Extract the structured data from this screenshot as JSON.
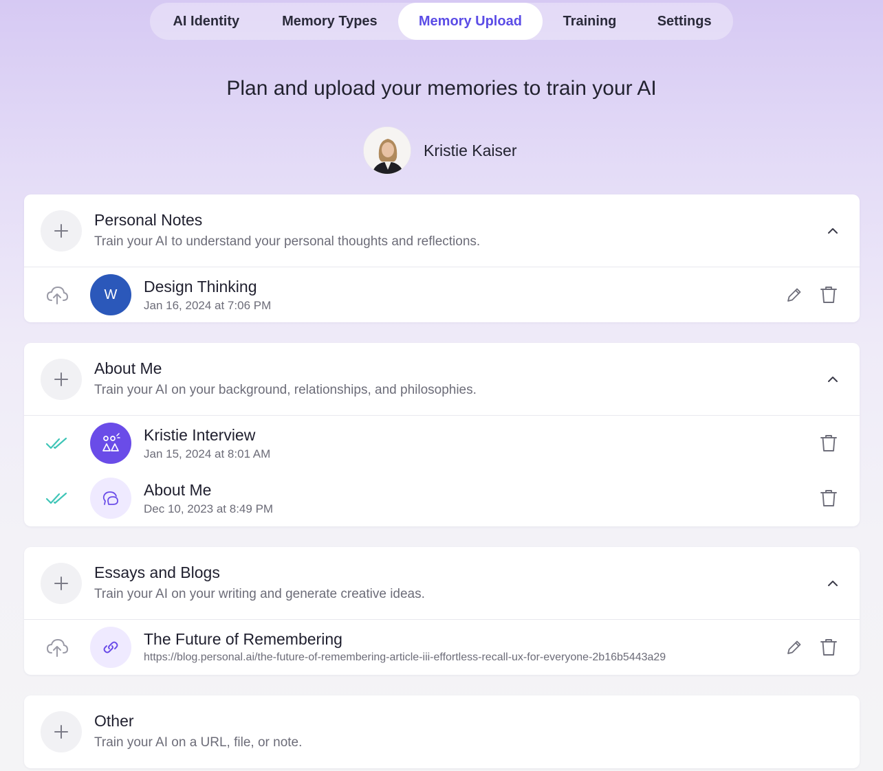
{
  "tabs": [
    {
      "label": "AI Identity",
      "active": false
    },
    {
      "label": "Memory Types",
      "active": false
    },
    {
      "label": "Memory Upload",
      "active": true
    },
    {
      "label": "Training",
      "active": false
    },
    {
      "label": "Settings",
      "active": false
    }
  ],
  "heading": "Plan and upload your memories to train your AI",
  "profile": {
    "name": "Kristie Kaiser"
  },
  "colors": {
    "accent": "#5b4ce6",
    "success": "#3fc5b7",
    "word_blue": "#2b58ba"
  },
  "sections": [
    {
      "title": "Personal Notes",
      "description": "Train your AI to understand your personal thoughts and reflections.",
      "items": [
        {
          "title": "Design Thinking",
          "subtitle": "Jan 16, 2024 at 7:06 PM",
          "status": "upload-cloud-icon",
          "thumb": "word-doc-icon",
          "thumb_letter": "W",
          "actions": [
            "edit",
            "delete"
          ]
        }
      ]
    },
    {
      "title": "About Me",
      "description": "Train your AI on your background, relationships, and philosophies.",
      "items": [
        {
          "title": "Kristie Interview",
          "subtitle": "Jan 15, 2024 at 8:01 AM",
          "status": "double-check-icon",
          "thumb": "interview-icon",
          "actions": [
            "delete"
          ]
        },
        {
          "title": "About Me",
          "subtitle": "Dec 10, 2023 at 8:49 PM",
          "status": "double-check-icon",
          "thumb": "chat-bubbles-icon",
          "actions": [
            "delete"
          ]
        }
      ]
    },
    {
      "title": "Essays and Blogs",
      "description": "Train your AI on your writing and generate creative ideas.",
      "items": [
        {
          "title": "The Future of Remembering",
          "subtitle": "https://blog.personal.ai/the-future-of-remembering-article-iii-effortless-recall-ux-for-everyone-2b16b5443a29",
          "status": "upload-cloud-icon",
          "thumb": "link-icon",
          "actions": [
            "edit",
            "delete"
          ]
        }
      ]
    },
    {
      "title": "Other",
      "description": "Train your AI on a URL, file, or note.",
      "items": []
    }
  ]
}
